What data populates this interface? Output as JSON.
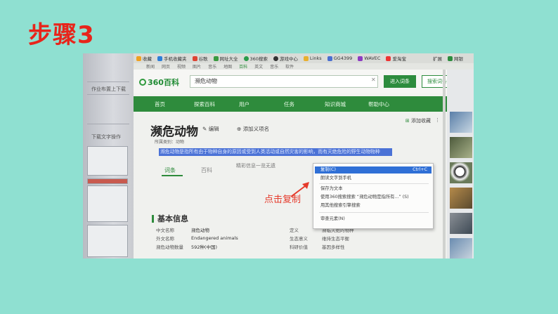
{
  "slide": {
    "title": "步骤3"
  },
  "left_pane": {
    "texts": [
      "作业布置上下载",
      "下载文字操作"
    ]
  },
  "bookmarks": [
    "收藏",
    "手机收藏夹",
    "谷歌",
    "网址大全",
    "360搜索",
    "游戏中心",
    "Links",
    "GG4399",
    "WAVEC",
    "爱淘宝",
    "扩展",
    "网银"
  ],
  "subnav": [
    "新闻",
    "网页",
    "视频",
    "图片",
    "音乐",
    "地图",
    "百科",
    "英文",
    "音乐",
    "软件"
  ],
  "search": {
    "logo": "360百科",
    "value": "濒危动物",
    "enter_label": "进入词条",
    "search_label": "搜索词条"
  },
  "nav": [
    "首页",
    "探索百科",
    "用户",
    "任务",
    "知识商城",
    "帮助中心"
  ],
  "entry": {
    "title": "濒危动物",
    "edit": "编辑",
    "add_synonym": "添加义项名",
    "category": "所属类别：动物",
    "favorite": "添加收藏",
    "highlight_text": "濒危动物是指所有由于物种自身的原因或受到人类活动或自然灾害的影响，而有灭绝危险的野生动物物种",
    "tab_active": "词条",
    "tab_inactive": "百科",
    "info_link": "精彩信息一览无遗",
    "section_title": "基本信息",
    "info": [
      {
        "k": "中文名称",
        "v": "濒危动物",
        "k2": "定义",
        "v2": "濒临灭绝的物种"
      },
      {
        "k": "外文名称",
        "v": "Endangered animals",
        "k2": "生态意义",
        "v2": "维持生态平衡"
      },
      {
        "k": "濒危动物数量",
        "v": "592种(中国)",
        "k2": "科研价值",
        "v2": "基因多样性"
      }
    ]
  },
  "context_menu": {
    "copy": "复制(C)",
    "copy_shortcut": "Ctrl+C",
    "items": [
      "朗读文字到手机",
      "保存为文本",
      "使用360搜索搜索 “濒危动物是指所有...” (S)",
      "用其他搜索引擎搜索",
      "审查元素(N)"
    ]
  },
  "annotation": "点击复制",
  "colors": {
    "accent": "#2e8b3c",
    "annotation": "#e53b2c",
    "selection": "#2f6fd6"
  }
}
